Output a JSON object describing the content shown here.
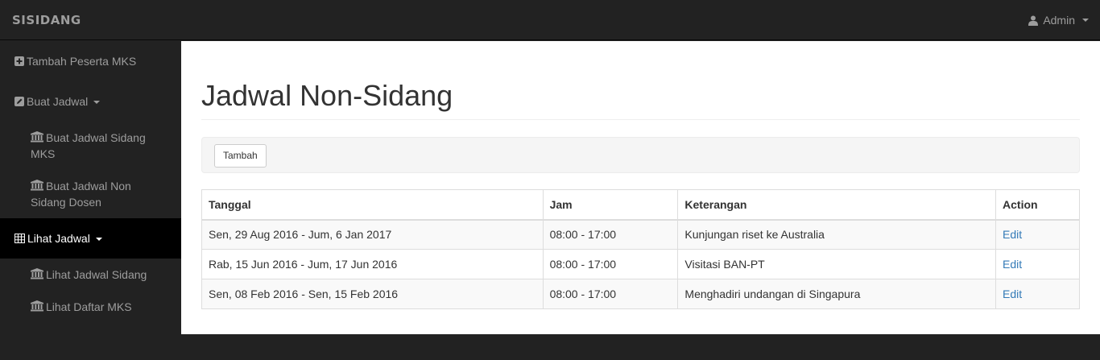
{
  "navbar": {
    "brand": "SISIDANG",
    "user": "Admin"
  },
  "sidebar": {
    "items": [
      {
        "label": "Tambah Peserta MKS",
        "icon": "plus-square-icon"
      },
      {
        "label": "Buat Jadwal",
        "icon": "edit-icon"
      },
      {
        "line1": "Buat Jadwal Sidang",
        "line2": "MKS",
        "icon": "institution-icon"
      },
      {
        "line1": "Buat Jadwal Non",
        "line2": "Sidang Dosen",
        "icon": "institution-icon"
      },
      {
        "label": "Lihat Jadwal",
        "icon": "table-icon"
      },
      {
        "label": "Lihat Jadwal Sidang",
        "icon": "institution-icon"
      },
      {
        "label": "Lihat Daftar MKS",
        "icon": "institution-icon"
      }
    ]
  },
  "main": {
    "title": "Jadwal Non-Sidang",
    "add_button": "Tambah",
    "table": {
      "headers": [
        "Tanggal",
        "Jam",
        "Keterangan",
        "Action"
      ],
      "rows": [
        {
          "tanggal": "Sen, 29 Aug 2016 - Jum, 6 Jan 2017",
          "jam": "08:00 - 17:00",
          "keterangan": "Kunjungan riset ke Australia",
          "action": "Edit"
        },
        {
          "tanggal": "Rab, 15 Jun 2016 - Jum, 17 Jun 2016",
          "jam": "08:00 - 17:00",
          "keterangan": "Visitasi BAN-PT",
          "action": "Edit"
        },
        {
          "tanggal": "Sen, 08 Feb 2016 - Sen, 15 Feb 2016",
          "jam": "08:00 - 17:00",
          "keterangan": "Menghadiri undangan di Singapura",
          "action": "Edit"
        }
      ]
    }
  },
  "colors": {
    "navbar_bg": "#222222",
    "active_bg": "#000000",
    "link": "#337ab7"
  }
}
